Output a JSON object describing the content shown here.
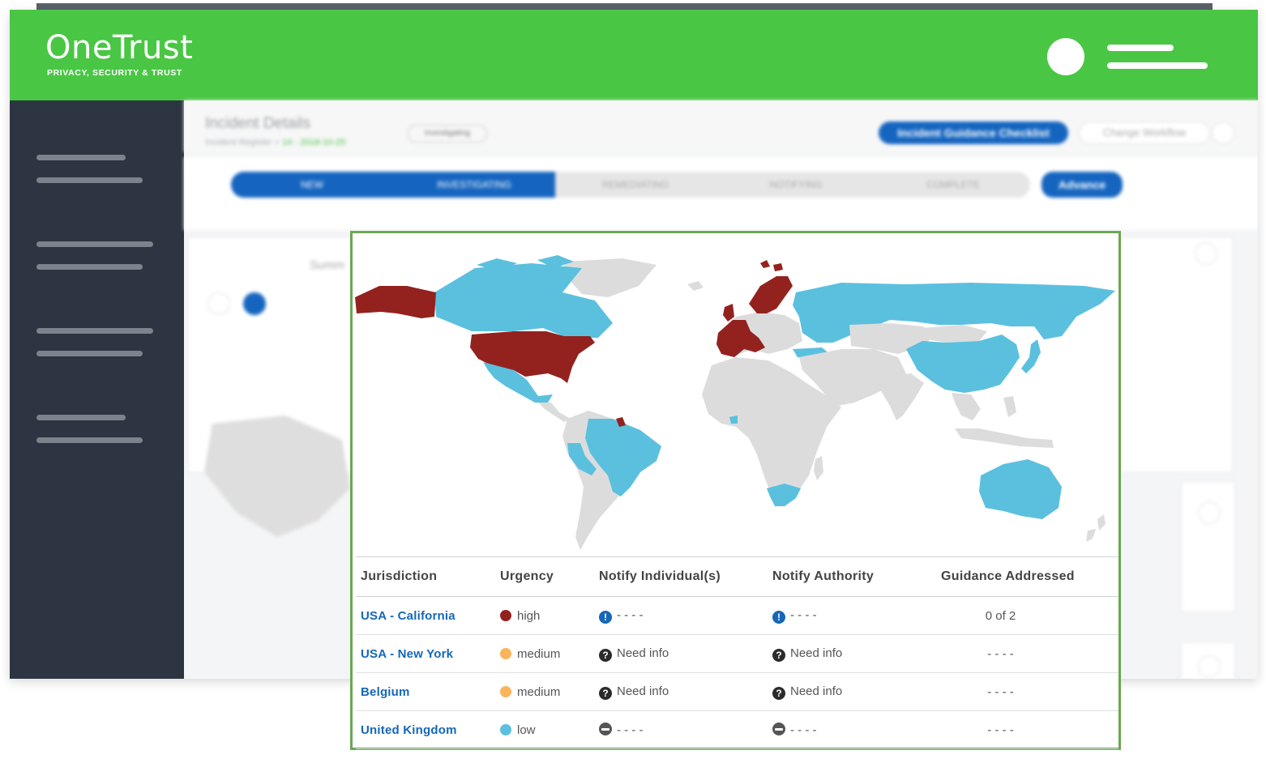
{
  "header": {
    "brand": "OneTrust",
    "tagline": "PRIVACY, SECURITY & TRUST"
  },
  "background": {
    "title": "Incident Details",
    "breadcrumb_root": "Incident Register",
    "breadcrumb_sep": ">",
    "breadcrumb_current": "14 - 2018-10-25",
    "status_pill": "Investigating",
    "guidance_button": "Incident Guidance Checklist",
    "workflow_button": "Change Workflow",
    "stages": [
      "NEW",
      "INVESTIGATING",
      "REMEDIATING",
      "NOTIFYING",
      "COMPLETE"
    ],
    "advance_button": "Advance",
    "summary_tab": "Summ"
  },
  "map": {
    "colors": {
      "high": "#93221f",
      "low": "#5bc0de",
      "none": "#dcdcdc"
    }
  },
  "table": {
    "headers": [
      "Jurisdiction",
      "Urgency",
      "Notify Individual(s)",
      "Notify Authority",
      "Guidance Addressed"
    ],
    "rows": [
      {
        "jurisdiction": "USA - California",
        "urgency": "high",
        "urgency_color": "#93221f",
        "notify_individuals": "- - - -",
        "notify_individuals_icon": "alert-icon",
        "notify_authority": "- - - -",
        "notify_authority_icon": "alert-icon",
        "guidance": "0 of 2"
      },
      {
        "jurisdiction": "USA - New York",
        "urgency": "medium",
        "urgency_color": "#fbb45c",
        "notify_individuals": "Need info",
        "notify_individuals_icon": "question-icon",
        "notify_authority": "Need info",
        "notify_authority_icon": "question-icon",
        "guidance": "- - - -"
      },
      {
        "jurisdiction": "Belgium",
        "urgency": "medium",
        "urgency_color": "#fbb45c",
        "notify_individuals": "Need info",
        "notify_individuals_icon": "question-icon",
        "notify_authority": "Need info",
        "notify_authority_icon": "question-icon",
        "guidance": "- - - -"
      },
      {
        "jurisdiction": "United Kingdom",
        "urgency": "low",
        "urgency_color": "#5bc0de",
        "notify_individuals": "- - - -",
        "notify_individuals_icon": "minus-icon",
        "notify_authority": "- - - -",
        "notify_authority_icon": "minus-icon",
        "guidance": "- - - -"
      }
    ]
  }
}
